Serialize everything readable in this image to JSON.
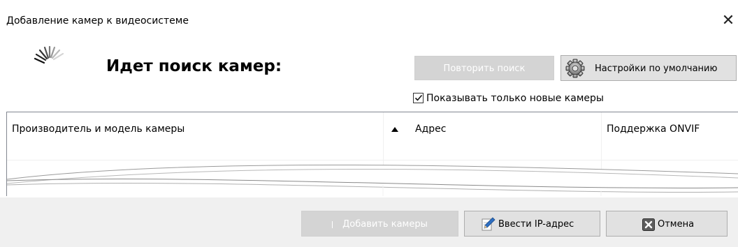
{
  "window": {
    "title": "Добавление камер к видеосистеме",
    "close_glyph": "✕"
  },
  "search": {
    "heading": "Идет поиск камер:",
    "spinner_icon": "loading-spinner-icon"
  },
  "toolbar": {
    "repeat_label": "Повторить поиск",
    "defaults_label": "Настройки по умолчанию",
    "defaults_icon": "gear-icon"
  },
  "filter": {
    "only_new_label": "Показывать только новые камеры",
    "only_new_checked": true
  },
  "table": {
    "columns": [
      {
        "label": "Производитель и модель камеры"
      },
      {
        "label": "Адрес",
        "sort": "ascending"
      },
      {
        "label": "Поддержка ONVIF"
      }
    ],
    "rows": []
  },
  "footer": {
    "add_label": "Добавить камеры",
    "enter_ip_label": "Ввести IP-адрес",
    "enter_ip_icon": "pencil-icon",
    "cancel_label": "Отмена",
    "cancel_icon": "close-box-icon"
  },
  "colors": {
    "button_bg": "#e1e1e1",
    "button_disabled_bg": "#d4d4d4",
    "footer_bg": "#f0f0f0"
  }
}
